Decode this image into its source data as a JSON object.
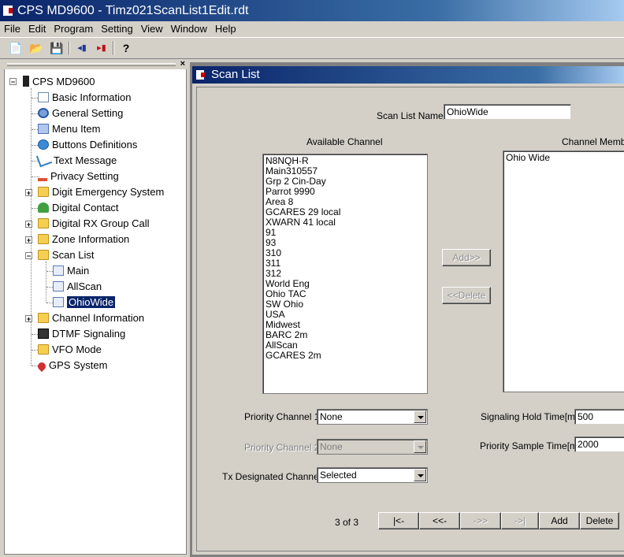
{
  "window": {
    "title": "CPS MD9600 - Timz021ScanList1Edit.rdt"
  },
  "menu": [
    "File",
    "Edit",
    "Program",
    "Setting",
    "View",
    "Window",
    "Help"
  ],
  "toolbar": {
    "new_icon": "📄",
    "open_icon": "📂",
    "save_icon": "💾",
    "read_icon": "◂▮",
    "write_icon": "▸▮",
    "help_icon": "?"
  },
  "tree": {
    "close": "×",
    "root": "CPS MD9600",
    "items": [
      "Basic Information",
      "General Setting",
      "Menu Item",
      "Buttons Definitions",
      "Text Message",
      "Privacy Setting",
      "Digit Emergency System",
      "Digital Contact",
      "Digital RX Group Call",
      "Zone Information",
      "Scan List",
      "Channel Information",
      "DTMF Signaling",
      "VFO Mode",
      "GPS System"
    ],
    "scan_children": [
      "Main",
      "AllScan",
      "OhioWide"
    ],
    "plus": "+",
    "minus": "−"
  },
  "scanlist": {
    "title": "Scan List",
    "name_label": "Scan List Name",
    "name_value": "OhioWide",
    "available_label": "Available Channel",
    "members_label": "Channel Member",
    "available": [
      "N8NQH-R",
      "Main310557",
      "Grp 2 Cin-Day",
      "Parrot 9990",
      "Area 8",
      "GCARES 29 local",
      "XWARN 41 local",
      "91",
      "93",
      "310",
      "311",
      "312",
      "World Eng",
      "Ohio TAC",
      "SW Ohio",
      "USA",
      "Midwest",
      "BARC 2m",
      "AllScan",
      "GCARES 2m"
    ],
    "members": [
      "Ohio Wide"
    ],
    "add_btn": "Add>>",
    "delete_btn": "<<Delete",
    "priority1_label": "Priority Channel 1",
    "priority1_value": "None",
    "priority2_label": "Priority Channel 2",
    "priority2_value": "None",
    "tx_label": "Tx Designated Channel",
    "tx_value": "Selected",
    "hold_label": "Signaling Hold Time[ms]",
    "hold_value": "500",
    "sample_label": "Priority Sample Time[ms]",
    "sample_value": "2000",
    "page": "3 of 3",
    "nav_first": "|<-",
    "nav_prev": "<<-",
    "nav_next": "->>",
    "nav_last": "->|",
    "add": "Add",
    "delete": "Delete"
  }
}
